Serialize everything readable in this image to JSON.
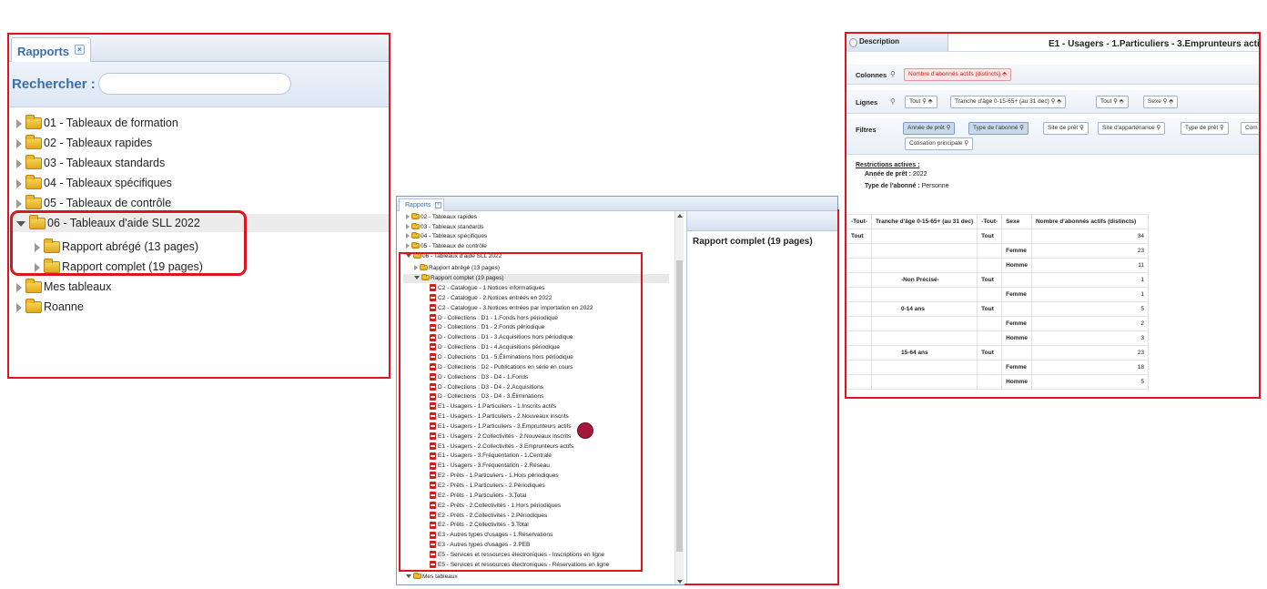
{
  "panel1": {
    "tab_label": "Rapports",
    "close_glyph": "×",
    "search_label": "Rechercher :",
    "search_value": "",
    "tree": [
      {
        "label": "01 - Tableaux de formation",
        "expanded": false
      },
      {
        "label": "02 - Tableaux rapides",
        "expanded": false
      },
      {
        "label": "03 - Tableaux standards",
        "expanded": false
      },
      {
        "label": "04 - Tableaux spécifiques",
        "expanded": false
      },
      {
        "label": "05 - Tableaux de contrôle",
        "expanded": false
      },
      {
        "label": "06 - Tableaux d'aide SLL 2022",
        "expanded": true
      },
      {
        "label": "Rapport abrégé (13 pages)",
        "expanded": false
      },
      {
        "label": "Rapport complet (19 pages)",
        "expanded": false
      },
      {
        "label": "Mes tableaux",
        "expanded": false
      },
      {
        "label": "Roanne",
        "expanded": false
      }
    ]
  },
  "panel2": {
    "tab_label": "Rapports",
    "close_glyph": "×",
    "right_title": "Rapport complet (19 pages)",
    "folders": [
      "02 - Tableaux rapides",
      "03 - Tableaux standards",
      "04 - Tableaux spécifiques",
      "05 - Tableaux de contrôle",
      "06 - Tableaux d'aide SLL 2022",
      "Rapport abrégé (13 pages)",
      "Rapport complet (19 pages)"
    ],
    "reports": [
      "C2 - Catalogue - 1.Notices informatiques",
      "C2 - Catalogue - 2.Notices entrées en 2022",
      "C2 - Catalogue - 3.Notices entrées par importation en 2022",
      "D - Collections : D1 - 1.Fonds hors périodique",
      "D - Collections : D1 - 2.Fonds périodique",
      "D - Collections : D1 - 3.Acquisitions hors périodique",
      "D - Collections : D1 - 4.Acquisitions périodique",
      "D - Collections : D1 - 5.Éliminations hors périodique",
      "D - Collections : D2 - Publications en série en cours",
      "D - Collections : D3 - D4 - 1.Fonds",
      "D - Collections : D3 - D4 - 2.Acquisitions",
      "D - Collections : D3 - D4 - 3.Éliminations",
      "E1 - Usagers - 1.Particuliers - 1.Inscrits actifs",
      "E1 - Usagers - 1.Particuliers - 2.Nouveaux inscrits",
      "E1 - Usagers - 1.Particuliers - 3.Emprunteurs actifs",
      "E1 - Usagers - 2.Collectivités - 2.Nouveaux inscrits",
      "E1 - Usagers - 2.Collectivités - 3.Emprunteurs actifs",
      "E1 - Usagers - 3.Fréquentation - 1.Centrale",
      "E1 - Usagers - 3.Fréquentation - 2.Réseau",
      "E2 - Prêts - 1.Particuliers - 1.Hors périodiques",
      "E2 - Prêts - 1.Particuliers - 2.Périodiques",
      "E2 - Prêts - 1.Particuliers - 3.Total",
      "E2 - Prêts - 2.Collectivités - 1.Hors périodiques",
      "E2 - Prêts - 2.Collectivités - 2.Périodiques",
      "E2 - Prêts - 2.Collectivités - 3.Total",
      "E3 - Autres types d'usages - 1.Réservations",
      "E3 - Autres types d'usages - 2.PEB",
      "E5 - Services et ressources électroniques - Inscriptions en ligne",
      "E5 - Services et ressources électroniques - Réservations en ligne"
    ],
    "bottom_folder": "Mes tableaux"
  },
  "panel3": {
    "description_tab": "Description",
    "title": "E1 - Usagers - 1.Particuliers - 3.Emprunteurs acti",
    "colonnes_label": "Colonnes",
    "colonnes_pills": [
      "Nombre d'abonnés actifs (distincts) ⬘"
    ],
    "lignes_label": "Lignes",
    "lignes_pills": [
      "Tout ⚲ ⬘",
      "Tranche d'âge 0-15-65+ (au 31 dec) ⚲ ⬘",
      "Tout ⚲ ⬘",
      "Sexe ⚲ ⬘"
    ],
    "filtres_label": "Filtres",
    "filtres_pills": [
      "Année de prêt ⚲",
      "Type de l'abonné ⚲",
      "Site de prêt ⚲",
      "Site d'appartenance ⚲",
      "Type de prêt ⚲",
      "Com",
      "Cotisation principale ⚲"
    ],
    "restrictions_title": "Restrictions actives :",
    "restrictions": [
      {
        "label": "Année de prêt :",
        "value": "2022"
      },
      {
        "label": "Type de l'abonné :",
        "value": "Personne"
      }
    ],
    "table": {
      "headers": [
        "-Tout-",
        "Tranche d'âge 0-15-65+ (au 31 dec)",
        "-Tout-",
        "Sexe",
        "Nombre d'abonnés actifs (distincts)"
      ],
      "rows": [
        [
          "Tout",
          "",
          "Tout",
          "",
          "34"
        ],
        [
          "",
          "",
          "",
          "Femme",
          "23"
        ],
        [
          "",
          "",
          "",
          "Homme",
          "11"
        ],
        [
          "",
          "-Non Précisé-",
          "Tout",
          "",
          "1"
        ],
        [
          "",
          "",
          "",
          "Femme",
          "1"
        ],
        [
          "",
          "0-14 ans",
          "Tout",
          "",
          "5"
        ],
        [
          "",
          "",
          "",
          "Femme",
          "2"
        ],
        [
          "",
          "",
          "",
          "Homme",
          "3"
        ],
        [
          "",
          "15-64 ans",
          "Tout",
          "",
          "23"
        ],
        [
          "",
          "",
          "",
          "Femme",
          "18"
        ],
        [
          "",
          "",
          "",
          "Homme",
          "5"
        ]
      ]
    }
  }
}
